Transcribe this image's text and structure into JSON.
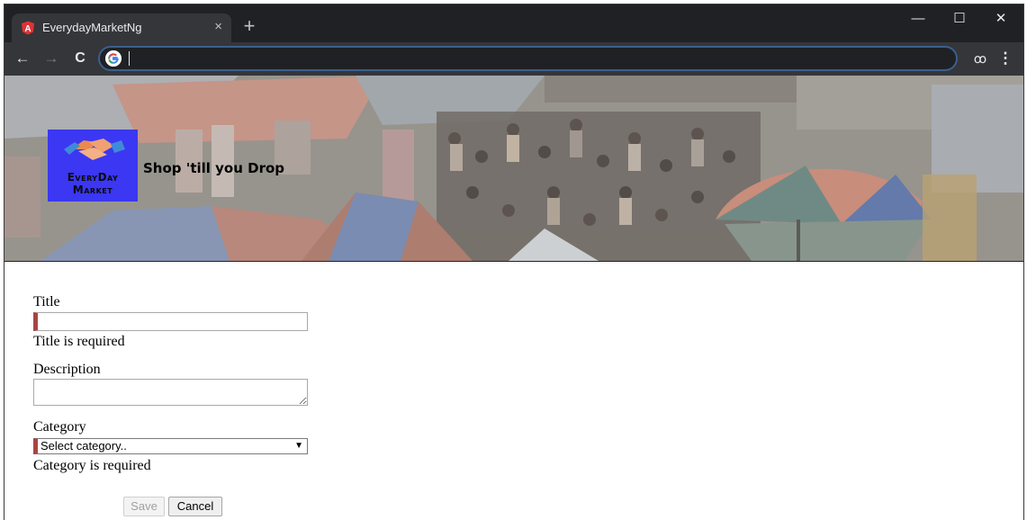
{
  "browser": {
    "tab_title": "EverydayMarketNg",
    "tab_close": "×",
    "new_tab": "+",
    "window_controls": {
      "minimize": "—",
      "maximize": "☐",
      "close": "✕"
    },
    "nav": {
      "back": "←",
      "forward": "→",
      "reload": "C"
    },
    "address_value": "",
    "menu_icon": "⋮",
    "incognito_icon": "ꝏ"
  },
  "hero": {
    "logo_line1": "EveryDay",
    "logo_line2": "Market",
    "tagline": "Shop 'till you Drop"
  },
  "form": {
    "title_label": "Title",
    "title_value": "",
    "title_error": "Title is required",
    "description_label": "Description",
    "description_value": "",
    "category_label": "Category",
    "category_selected": "Select category..",
    "category_error": "Category is required",
    "save_label": "Save",
    "cancel_label": "Cancel"
  },
  "colors": {
    "chrome_dark": "#202124",
    "chrome_toolbar": "#35363a",
    "logo_bg": "#3b37f2",
    "invalid_marker": "#a94442"
  }
}
